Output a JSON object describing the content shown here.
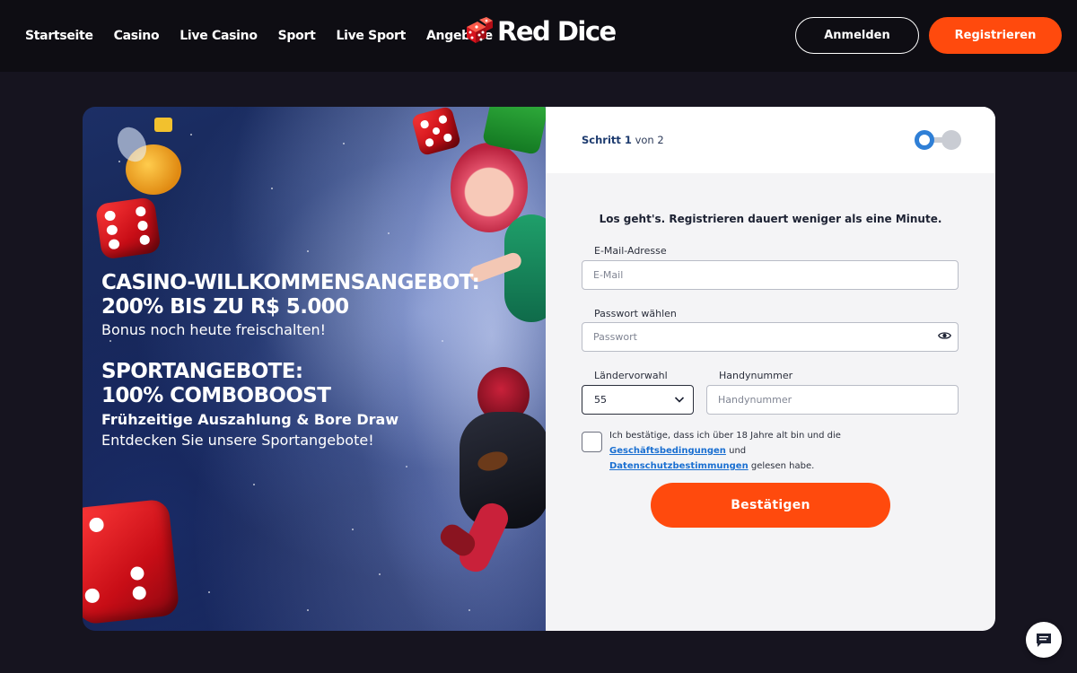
{
  "header": {
    "nav": [
      "Startseite",
      "Casino",
      "Live Casino",
      "Sport",
      "Live Sport",
      "Angebote"
    ],
    "logo": "Red Dice",
    "login_label": "Anmelden",
    "register_label": "Registrieren"
  },
  "promo": {
    "casino_title_1": "CASINO-WILLKOMMENSANGEBOT:",
    "casino_title_2": "200% BIS ZU R$ 5.000",
    "casino_sub": "Bonus noch heute freischalten!",
    "sport_title_1": "SPORTANGEBOTE:",
    "sport_title_2": "100% COMBOBOOST",
    "sport_sub_bold": "Frühzeitige Auszahlung & Bore Draw",
    "sport_sub": "Entdecken Sie unsere Sportangebote!"
  },
  "form": {
    "step_word": "Schritt",
    "step_current": "1",
    "step_total_text": "von 2",
    "headline": "Los geht's. Registrieren dauert weniger als eine Minute.",
    "email_label": "E-Mail-Adresse",
    "email_placeholder": "E-Mail",
    "password_label": "Passwort wählen",
    "password_placeholder": "Passwort",
    "country_label": "Ländervorwahl",
    "country_value": "55",
    "phone_label": "Handynummer",
    "phone_placeholder": "Handynummer",
    "terms_pre": "Ich bestätige, dass ich über 18 Jahre alt bin und die ",
    "terms_link1": "Geschäftsbedingungen",
    "terms_mid": " und ",
    "terms_link2": "Datenschutzbestimmungen",
    "terms_post": " gelesen habe.",
    "confirm_label": "Bestätigen"
  },
  "colors": {
    "accent": "#ff4a0d",
    "link": "#1a6fd1",
    "header_bg": "#0e0d13",
    "page_bg": "#16141f"
  },
  "icons": [
    "dice-logo-icon",
    "eye-icon",
    "chevron-down-icon",
    "chat-icon"
  ]
}
